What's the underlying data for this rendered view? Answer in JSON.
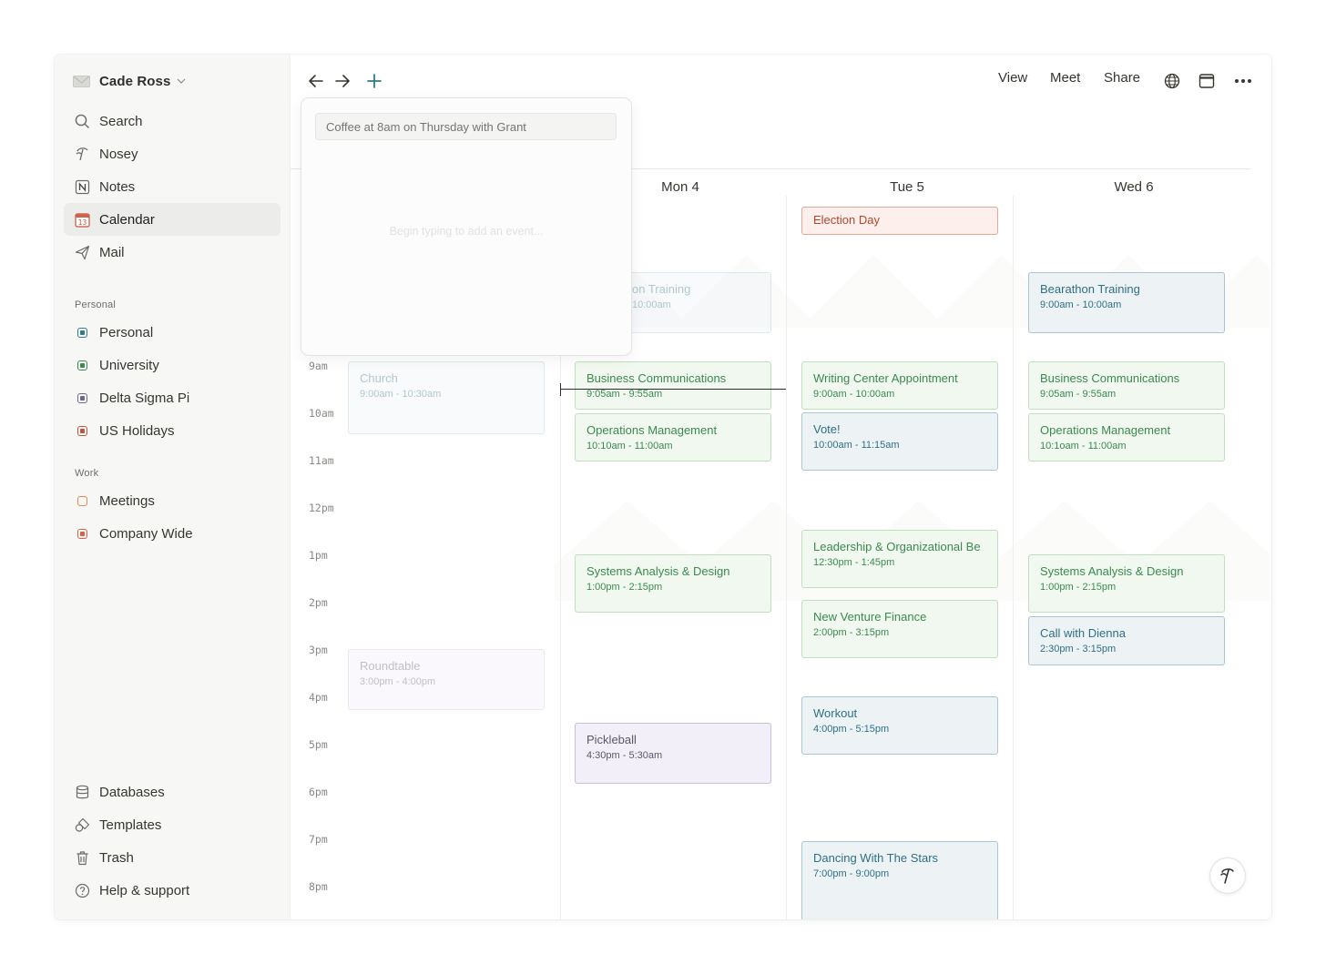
{
  "account": {
    "name": "Cade Ross"
  },
  "nav": {
    "search": "Search",
    "nosey": "Nosey",
    "notes": "Notes",
    "calendar": "Calendar",
    "mail": "Mail"
  },
  "sections": {
    "personal": {
      "heading": "Personal",
      "items": [
        "Personal",
        "University",
        "Delta Sigma Pi",
        "US Holidays"
      ]
    },
    "work": {
      "heading": "Work",
      "items": [
        "Meetings",
        "Company Wide"
      ]
    }
  },
  "bottom_nav": {
    "databases": "Databases",
    "templates": "Templates",
    "trash": "Trash",
    "help": "Help & support"
  },
  "toolbar": {
    "view": "View",
    "meet": "Meet",
    "share": "Share"
  },
  "quick_add": {
    "placeholder": "Coffee at 8am on Thursday with Grant",
    "hint": "Begin typing to add an event..."
  },
  "days": [
    "Mon 4",
    "Tue 5",
    "Wed 6"
  ],
  "times": [
    "9am",
    "10am",
    "11am",
    "12pm",
    "1pm",
    "2pm",
    "3pm",
    "4pm",
    "5pm",
    "6pm",
    "7pm",
    "8pm"
  ],
  "events": {
    "sun": [
      {
        "title": "Church",
        "time": "9:00am - 10:30am"
      },
      {
        "title": "Roundtable",
        "time": "3:00pm - 4:00pm"
      }
    ],
    "mon": [
      {
        "title": "on Training",
        "time": "10:00am"
      },
      {
        "title": "Business Communications",
        "time": "9:05am - 9:55am"
      },
      {
        "title": "Operations Management",
        "time": "10:10am - 11:00am"
      },
      {
        "title": "Systems Analysis & Design",
        "time": "1:00pm - 2:15pm"
      },
      {
        "title": "Pickleball",
        "time": "4:30pm - 5:30am"
      }
    ],
    "tue": [
      {
        "title": "Election Day"
      },
      {
        "title": "Writing Center Appointment",
        "time": "9:00am - 10:00am"
      },
      {
        "title": "Vote!",
        "time": "10:00am - 11:15am"
      },
      {
        "title": "Leadership & Organizational Be",
        "time": "12:30pm - 1:45pm"
      },
      {
        "title": "New Venture Finance",
        "time": "2:00pm - 3:15pm"
      },
      {
        "title": "Workout",
        "time": "4:00pm - 5:15pm"
      },
      {
        "title": "Dancing With The Stars",
        "time": "7:00pm - 9:00pm"
      }
    ],
    "wed": [
      {
        "title": "Bearathon Training",
        "time": "9:00am - 10:00am"
      },
      {
        "title": "Business Communications",
        "time": "9:05am - 9:55am"
      },
      {
        "title": "Operations Management",
        "time": "10:1oam - 11:00am"
      },
      {
        "title": "Systems Analysis & Design",
        "time": "1:00pm - 2:15pm"
      },
      {
        "title": "Call with Dienna",
        "time": "2:30pm - 3:15pm"
      }
    ]
  },
  "colors": {
    "green": "#3b8a50",
    "blue": "#2f6f86",
    "purple": "#5c5869",
    "red": "#b5452e",
    "accent": "#2f7d8a"
  },
  "icons": {
    "back": "arrow-left-icon",
    "forward": "arrow-right-icon",
    "add": "plus-icon",
    "globe": "globe-icon",
    "window": "window-icon",
    "more": "more-icon",
    "nosey": "nosey-icon"
  }
}
